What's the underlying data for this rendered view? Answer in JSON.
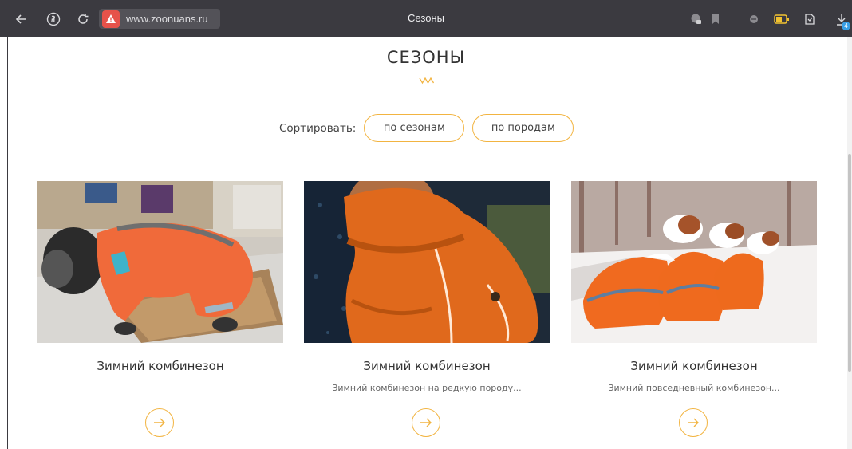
{
  "browser": {
    "url": "www.zoonuans.ru",
    "tab_title": "Сезоны",
    "download_count": "4"
  },
  "page": {
    "title": "СЕЗОНЫ",
    "sort": {
      "label": "Сортировать:",
      "by_season": "по сезонам",
      "by_breed": "по породам"
    },
    "accent_color": "#f2b441",
    "cards": [
      {
        "title": "Зимний комбинезон",
        "description": "",
        "image": "schnauzer in orange winter overall on tiled floor"
      },
      {
        "title": "Зимний комбинезон",
        "description": "Зимний комбинезон на редкую породу...",
        "image": "dog in hooded orange winter overall"
      },
      {
        "title": "Зимний комбинезон",
        "description": "Зимний повседневный комбинезон...",
        "image": "three jack russell terriers in orange overalls on snow"
      }
    ]
  }
}
